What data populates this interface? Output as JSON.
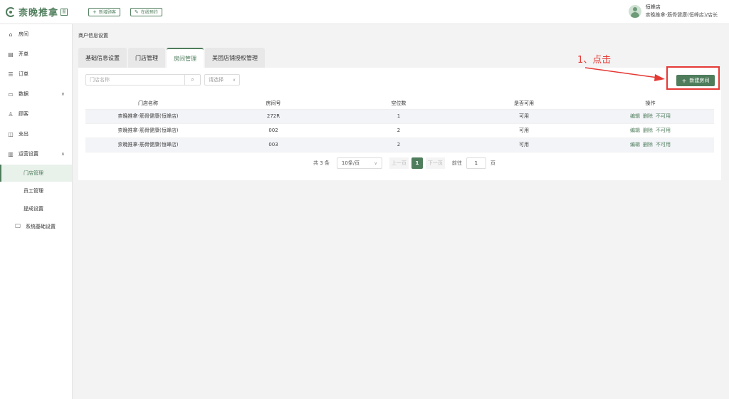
{
  "header": {
    "logo_text": "柰晚推拿",
    "logo_badge": "图",
    "btn_new_customer": "新增顾客",
    "btn_online_booking": "在线预约",
    "user_name": "恒峰店",
    "user_role": "柰晚推拿-筋骨健康(恒峰店)/店长"
  },
  "sidebar": {
    "items": [
      {
        "label": "房间",
        "icon": "home-icon"
      },
      {
        "label": "开单",
        "icon": "file-icon"
      },
      {
        "label": "订单",
        "icon": "list-icon"
      },
      {
        "label": "数据",
        "icon": "chart-icon"
      },
      {
        "label": "顾客",
        "icon": "user-icon"
      },
      {
        "label": "支出",
        "icon": "wallet-icon"
      },
      {
        "label": "运营设置",
        "icon": "settings-icon"
      }
    ],
    "sub_items": [
      "门店管理",
      "员工管理",
      "提成设置"
    ],
    "system_item": "系统基础设置"
  },
  "main": {
    "breadcrumb": "商户信息设置",
    "tabs": [
      "基础信息设置",
      "门店管理",
      "房间管理",
      "美团店铺授权管理"
    ],
    "active_tab": "房间管理",
    "search_placeholder": "门店名称",
    "select_placeholder": "请选择",
    "add_room_button": "新建房间",
    "table": {
      "headers": [
        "门店名称",
        "房间号",
        "空位数",
        "是否可用",
        "操作"
      ],
      "rows": [
        {
          "store": "柰晚推拿-筋骨健康(恒峰店)",
          "room": "272R",
          "seats": "1",
          "available": "可用"
        },
        {
          "store": "柰晚推拿-筋骨健康(恒峰店)",
          "room": "002",
          "seats": "2",
          "available": "可用"
        },
        {
          "store": "柰晚推拿-筋骨健康(恒峰店)",
          "room": "003",
          "seats": "2",
          "available": "可用"
        }
      ],
      "actions": [
        "编辑",
        "删除",
        "不可用"
      ]
    },
    "pager": {
      "total": "共 3 条",
      "page_size": "10条/页",
      "prev": "上一页",
      "current": "1",
      "next": "下一页",
      "goto_label": "前往",
      "goto_value": "1",
      "goto_suffix": "页"
    }
  },
  "annotation": {
    "text": "1、点击",
    "color": "#e53935"
  },
  "colors": {
    "accent": "#4f7d5c"
  }
}
